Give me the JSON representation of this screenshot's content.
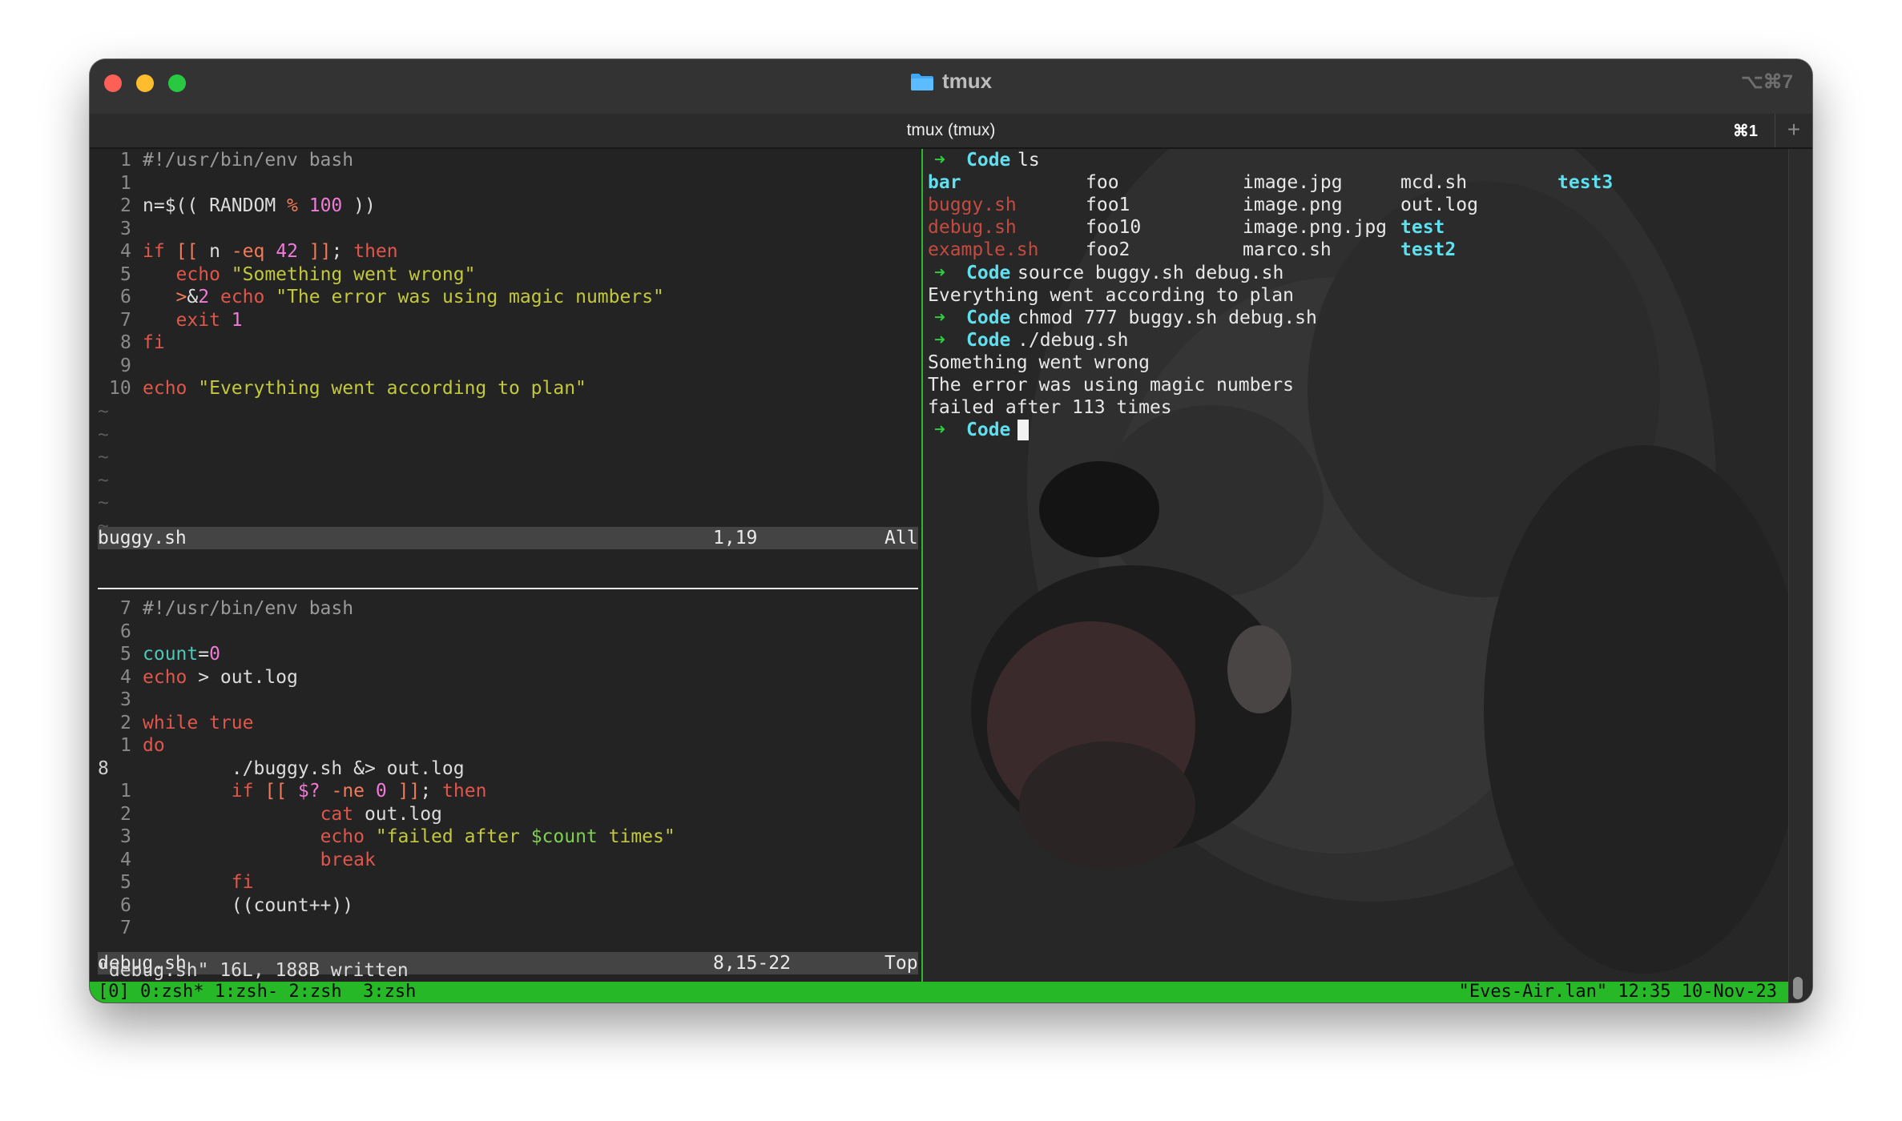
{
  "window": {
    "title": "tmux",
    "shortcut": "⌥⌘7",
    "tab_title": "tmux (tmux)",
    "tab_shortcut": "⌘1",
    "new_tab": "+"
  },
  "top_pane": {
    "lines": [
      {
        "num": "1",
        "text": "#!/usr/bin/env bash"
      },
      {
        "num": "1",
        "text": ""
      },
      {
        "num": "2",
        "text": "n=$(( RANDOM % 100 ))"
      },
      {
        "num": "3",
        "text": ""
      },
      {
        "num": "4",
        "text": "if [[ n -eq 42 ]]; then"
      },
      {
        "num": "5",
        "text": "   echo \"Something went wrong\""
      },
      {
        "num": "6",
        "text": "   >&2 echo \"The error was using magic numbers\""
      },
      {
        "num": "7",
        "text": "   exit 1"
      },
      {
        "num": "8",
        "text": "fi"
      },
      {
        "num": "9",
        "text": ""
      },
      {
        "num": "10",
        "text": "echo \"Everything went according to plan\""
      }
    ],
    "tilde": "~",
    "status": {
      "file": "buggy.sh",
      "pos": "1,19",
      "scroll": "All"
    }
  },
  "bottom_pane": {
    "lines": [
      {
        "num": "7",
        "text": "#!/usr/bin/env bash"
      },
      {
        "num": "6",
        "text": ""
      },
      {
        "num": "5",
        "text": "count=0"
      },
      {
        "num": "4",
        "text": "echo > out.log"
      },
      {
        "num": "3",
        "text": ""
      },
      {
        "num": "2",
        "text": "while true"
      },
      {
        "num": "1",
        "text": "do"
      },
      {
        "num": "8",
        "text": "        ./buggy.sh &> out.log"
      },
      {
        "num": "1",
        "text": "        if [[ $? -ne 0 ]]; then"
      },
      {
        "num": "2",
        "text": "                cat out.log"
      },
      {
        "num": "3",
        "text": "                echo \"failed after $count times\""
      },
      {
        "num": "4",
        "text": "                break"
      },
      {
        "num": "5",
        "text": "        fi"
      },
      {
        "num": "6",
        "text": "        ((count++))"
      },
      {
        "num": "7",
        "text": ""
      }
    ],
    "status": {
      "file": "debug.sh",
      "pos": "8,15-22",
      "scroll": "Top"
    },
    "message": "\"debug.sh\" 16L, 188B written"
  },
  "terminal": {
    "prompt_arrow": "➜",
    "prompt_dir": "Code",
    "cmd_ls": "ls",
    "ls_rows": [
      [
        "bar",
        "foo",
        "image.jpg",
        "mcd.sh",
        "test3"
      ],
      [
        "buggy.sh",
        "foo1",
        "image.png",
        "out.log",
        ""
      ],
      [
        "debug.sh",
        "foo10",
        "image.png.jpg",
        "test",
        ""
      ],
      [
        "example.sh",
        "foo2",
        "marco.sh",
        "test2",
        ""
      ]
    ],
    "cmd_source": "source buggy.sh debug.sh",
    "out_source": "Everything went according to plan",
    "cmd_chmod": "chmod 777 buggy.sh debug.sh",
    "cmd_debug": "./debug.sh",
    "out_debug": [
      "Something went wrong",
      "The error was using magic numbers",
      "failed after 113 times"
    ]
  },
  "statusbar": {
    "left": "[0] 0:zsh* 1:zsh- 2:zsh  3:zsh",
    "right": "\"Eves-Air.lan\" 12:35 10-Nov-23"
  },
  "colors": {
    "bar_green": "#27b827",
    "keyword": "#e0564b",
    "string": "#c3c83d",
    "variable": "#4ec6b6",
    "number": "#f07ad8",
    "dir_cyan": "#5ee0f0"
  }
}
